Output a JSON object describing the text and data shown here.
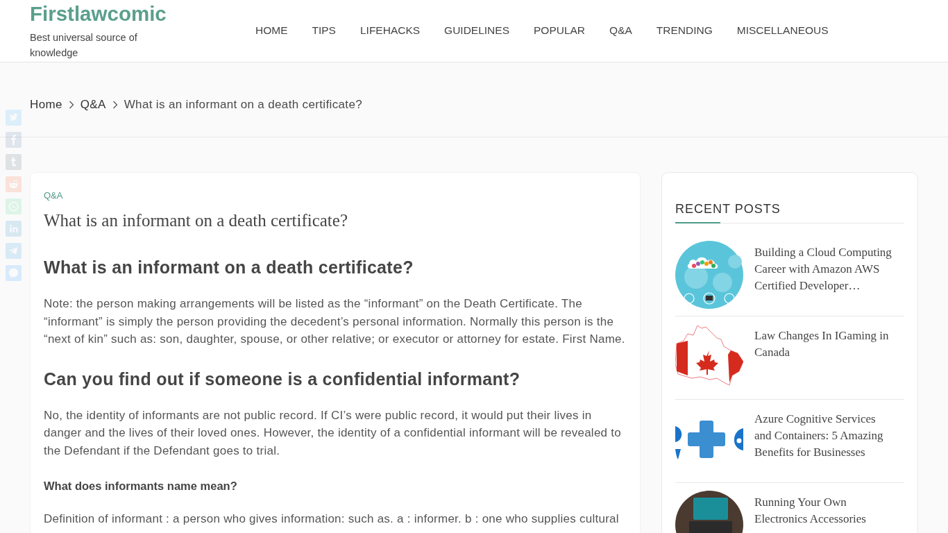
{
  "header": {
    "logo": "Firstlawcomic",
    "tagline": "Best universal source of knowledge",
    "nav": [
      {
        "label": "HOME"
      },
      {
        "label": "TIPS"
      },
      {
        "label": "LIFEHACKS"
      },
      {
        "label": "GUIDELINES"
      },
      {
        "label": "POPULAR"
      },
      {
        "label": "Q&A"
      },
      {
        "label": "TRENDING"
      },
      {
        "label": "MISCELLANEOUS"
      }
    ]
  },
  "breadcrumb": [
    {
      "label": "Home",
      "kind": "link"
    },
    {
      "label": "Q&A",
      "kind": "link"
    },
    {
      "label": "What is an informant on a death certificate?",
      "kind": "current"
    }
  ],
  "article": {
    "category": "Q&A",
    "title": "What is an informant on a death certificate?",
    "blocks": [
      {
        "kind": "h2",
        "text": "What is an informant on a death certificate?"
      },
      {
        "kind": "p",
        "text": "Note: the person making arrangements will be listed as the “informant” on the Death Certificate. The “informant” is simply the person providing the decedent’s personal information. Normally this person is the “next of kin” such as: son, daughter, spouse, or other relative; or executor or attorney for estate. First Name."
      },
      {
        "kind": "h2",
        "text": "Can you find out if someone is a confidential informant?"
      },
      {
        "kind": "p",
        "text": "No, the identity of informants are not public record. If CI’s were public record, it would put their lives in danger and the lives of their loved ones. However, the identity of a confidential informant will be revealed to the Defendant if the Defendant goes to trial."
      },
      {
        "kind": "h3",
        "text": "What does informants name mean?"
      },
      {
        "kind": "p",
        "text": "Definition of informant : a person who gives information: such as. a : informer. b : one who supplies cultural"
      }
    ]
  },
  "sidebar": {
    "title": "RECENT POSTS",
    "posts": [
      {
        "title": "Building a Cloud Computing Career with Amazon AWS Certified Developer…",
        "kind": "cloud"
      },
      {
        "title": "Law Changes In IGaming in Canada",
        "kind": "map"
      },
      {
        "title": "Azure Cognitive Services and Containers: 5 Amazing Benefits for Businesses",
        "kind": "plus"
      },
      {
        "title": "Running Your Own Electronics Accessories",
        "kind": "photo"
      }
    ]
  }
}
